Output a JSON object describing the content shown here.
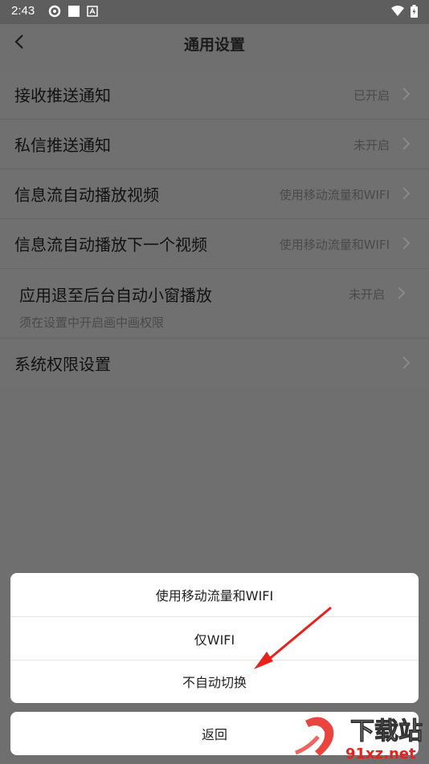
{
  "status_bar": {
    "time": "2:43"
  },
  "header": {
    "title": "通用设置"
  },
  "settings": [
    {
      "label": "接收推送通知",
      "value": "已开启"
    },
    {
      "label": "私信推送通知",
      "value": "未开启"
    },
    {
      "label": "信息流自动播放视频",
      "value": "使用移动流量和WIFI"
    },
    {
      "label": "信息流自动播放下一个视频",
      "value": "使用移动流量和WIFI"
    },
    {
      "label": "应用退至后台自动小窗播放",
      "value": "未开启",
      "sub": "须在设置中开启画中画权限"
    },
    {
      "label": "系统权限设置",
      "value": ""
    }
  ],
  "sheet": {
    "options": [
      "使用移动流量和WIFI",
      "仅WIFI",
      "不自动切换"
    ],
    "cancel": "返回"
  },
  "watermark": {
    "brand": "下载站",
    "domain": "91xz.net"
  },
  "colors": {
    "overlay": "#6f6f6f",
    "sheet": "#ffffff",
    "annotation_arrow": "#e8221b"
  }
}
